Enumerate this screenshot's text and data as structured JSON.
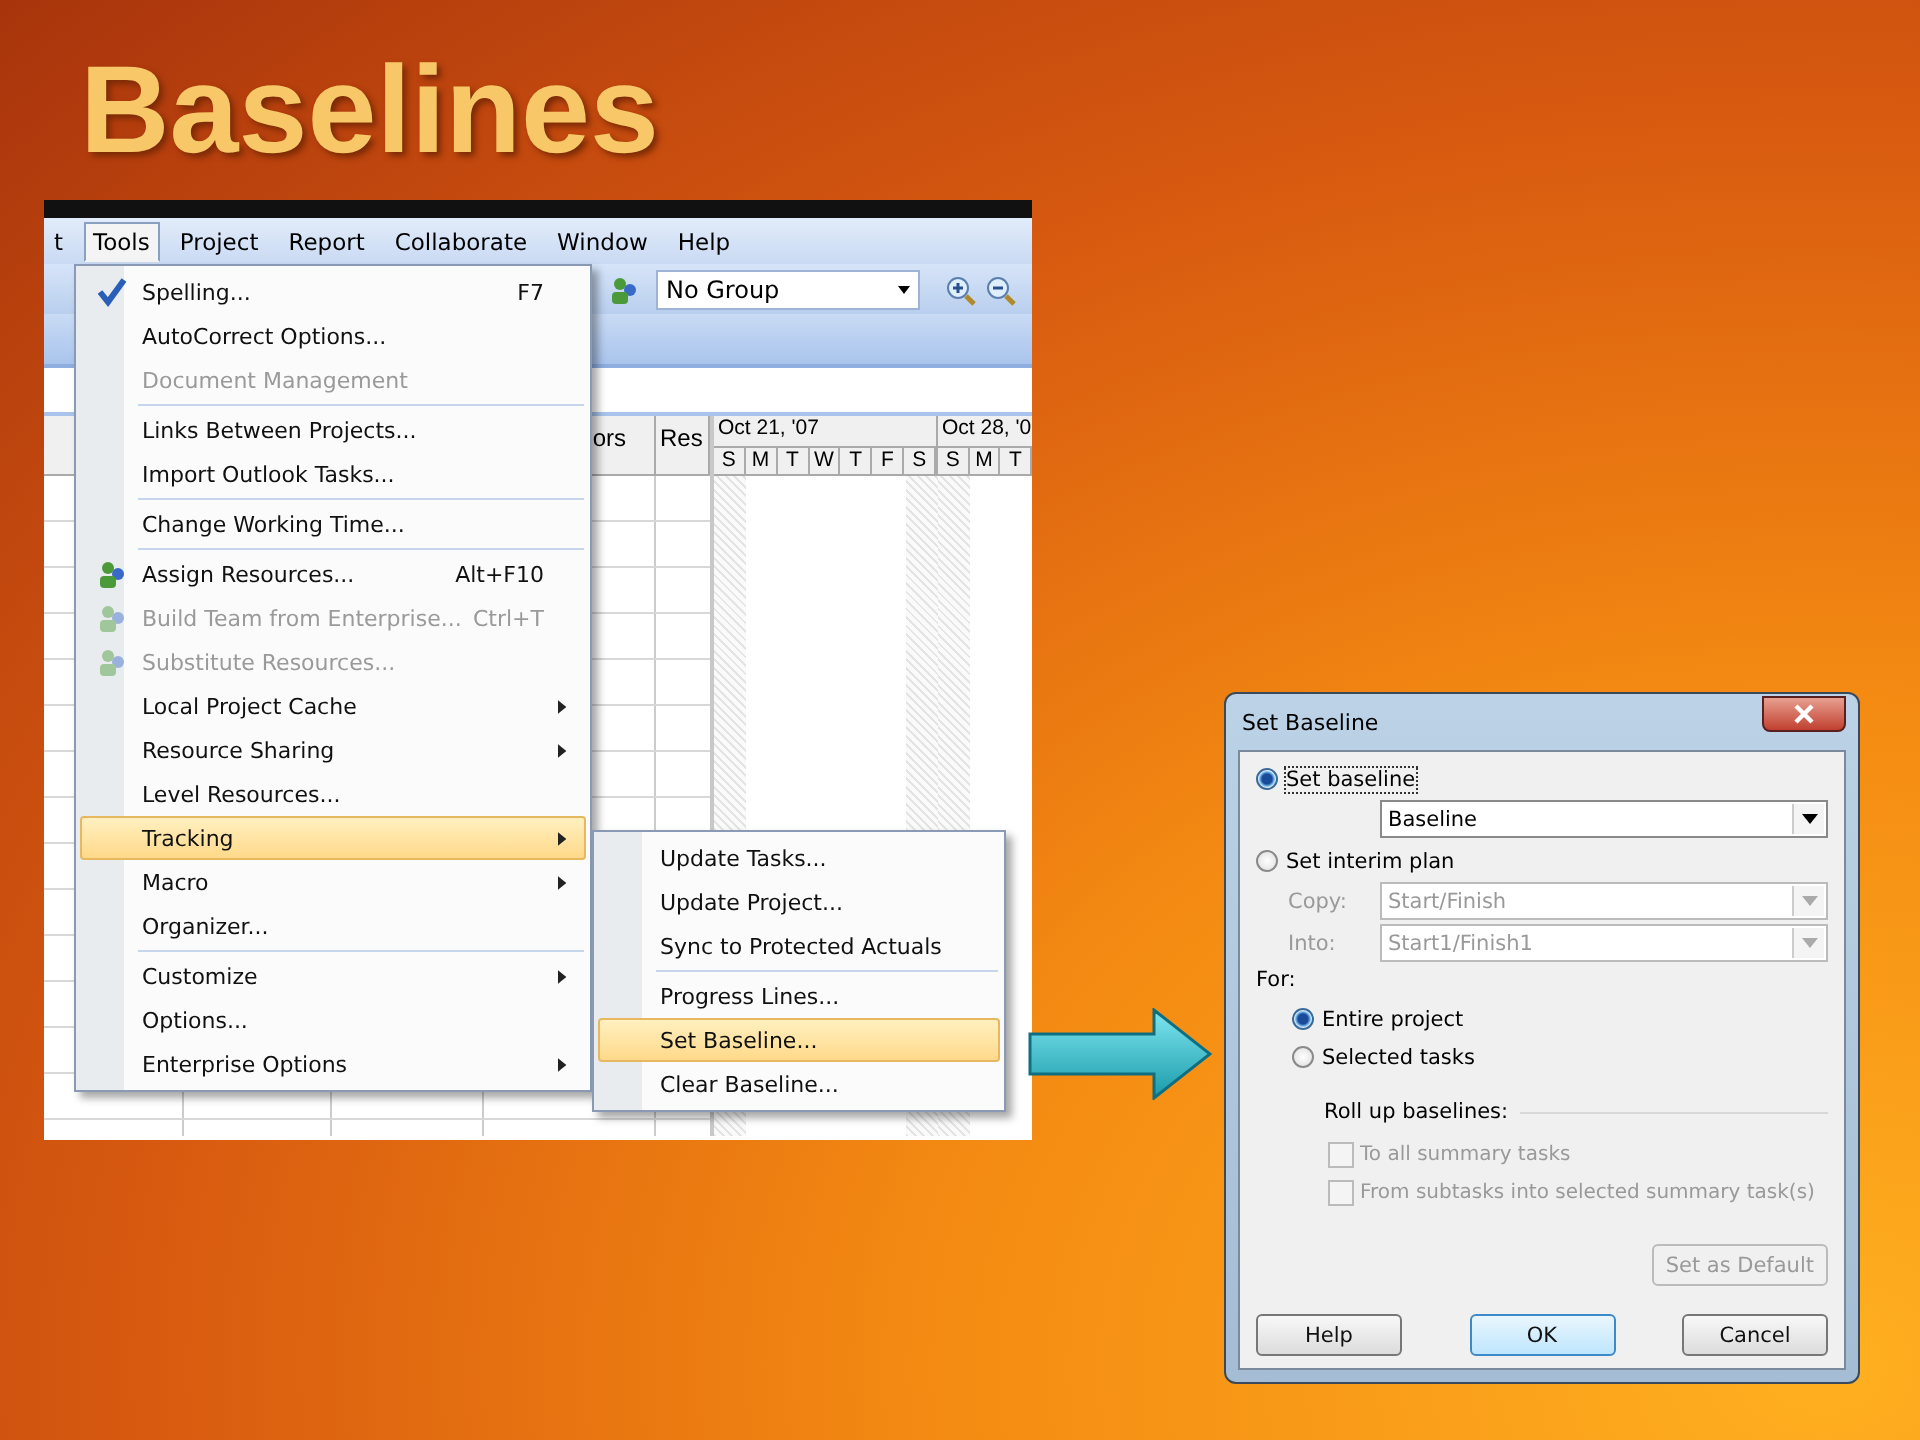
{
  "slide": {
    "title": "Baselines"
  },
  "app": {
    "menu_bar": [
      {
        "label": "t",
        "selected": false
      },
      {
        "label": "Tools",
        "selected": true
      },
      {
        "label": "Project",
        "selected": false
      },
      {
        "label": "Report",
        "selected": false
      },
      {
        "label": "Collaborate",
        "selected": false
      },
      {
        "label": "Window",
        "selected": false
      },
      {
        "label": "Help",
        "selected": false
      }
    ],
    "group_dropdown": {
      "value": "No Group"
    },
    "table": {
      "columns": [
        "ors",
        "Res"
      ]
    },
    "timescale": [
      {
        "label": "Oct 21, '07",
        "days": [
          "S",
          "M",
          "T",
          "W",
          "T",
          "F",
          "S"
        ]
      },
      {
        "label": "Oct 28, '0",
        "days": [
          "S",
          "M",
          "T"
        ]
      }
    ]
  },
  "tools_menu": [
    {
      "label": "Spelling...",
      "shortcut": "F7",
      "kind": "spell",
      "disabled": false,
      "group_start": false,
      "submenu": false,
      "selected": false
    },
    {
      "label": "AutoCorrect Options...",
      "kind": "plain",
      "disabled": false,
      "group_start": false,
      "submenu": false,
      "selected": false
    },
    {
      "label": "Document Management",
      "kind": "plain",
      "disabled": true,
      "group_start": false,
      "submenu": false,
      "selected": false
    },
    {
      "label": "Links Between Projects...",
      "kind": "plain",
      "disabled": false,
      "group_start": true,
      "submenu": false,
      "selected": false
    },
    {
      "label": "Import Outlook Tasks...",
      "kind": "plain",
      "disabled": false,
      "group_start": false,
      "submenu": false,
      "selected": false
    },
    {
      "label": "Change Working Time...",
      "kind": "plain",
      "disabled": false,
      "group_start": true,
      "submenu": false,
      "selected": false
    },
    {
      "label": "Assign Resources...",
      "shortcut": "Alt+F10",
      "kind": "people",
      "disabled": false,
      "group_start": true,
      "submenu": false,
      "selected": false
    },
    {
      "label": "Build Team from Enterprise...",
      "shortcut": "Ctrl+T",
      "kind": "people",
      "disabled": true,
      "group_start": false,
      "submenu": false,
      "selected": false
    },
    {
      "label": "Substitute Resources...",
      "kind": "people",
      "disabled": true,
      "group_start": false,
      "submenu": false,
      "selected": false
    },
    {
      "label": "Local Project Cache",
      "kind": "plain",
      "disabled": false,
      "group_start": false,
      "submenu": true,
      "selected": false
    },
    {
      "label": "Resource Sharing",
      "kind": "plain",
      "disabled": false,
      "group_start": false,
      "submenu": true,
      "selected": false
    },
    {
      "label": "Level Resources...",
      "kind": "plain",
      "disabled": false,
      "group_start": false,
      "submenu": false,
      "selected": false
    },
    {
      "label": "Tracking",
      "kind": "plain",
      "disabled": false,
      "group_start": false,
      "submenu": true,
      "selected": true
    },
    {
      "label": "Macro",
      "kind": "plain",
      "disabled": false,
      "group_start": false,
      "submenu": true,
      "selected": false
    },
    {
      "label": "Organizer...",
      "kind": "plain",
      "disabled": false,
      "group_start": false,
      "submenu": false,
      "selected": false
    },
    {
      "label": "Customize",
      "kind": "plain",
      "disabled": false,
      "group_start": true,
      "submenu": true,
      "selected": false
    },
    {
      "label": "Options...",
      "kind": "plain",
      "disabled": false,
      "group_start": false,
      "submenu": false,
      "selected": false
    },
    {
      "label": "Enterprise Options",
      "kind": "plain",
      "disabled": false,
      "group_start": false,
      "submenu": true,
      "selected": false
    }
  ],
  "tracking_menu": [
    {
      "label": "Update Tasks...",
      "group_start": false,
      "selected": false
    },
    {
      "label": "Update Project...",
      "group_start": false,
      "selected": false
    },
    {
      "label": "Sync to Protected Actuals",
      "group_start": false,
      "selected": false
    },
    {
      "label": "Progress Lines...",
      "group_start": true,
      "selected": false
    },
    {
      "label": "Set Baseline...",
      "group_start": false,
      "selected": true
    },
    {
      "label": "Clear Baseline...",
      "group_start": false,
      "selected": false
    }
  ],
  "dialog": {
    "title": "Set Baseline",
    "baseline_radio": {
      "label": "Set baseline",
      "selected": true
    },
    "baseline_dropdown": {
      "value": "Baseline",
      "disabled": false
    },
    "interim_radio": {
      "label": "Set interim plan",
      "selected": false
    },
    "copy": {
      "label": "Copy:",
      "value": "Start/Finish",
      "disabled": true
    },
    "into": {
      "label": "Into:",
      "value": "Start1/Finish1",
      "disabled": true
    },
    "for_label": "For:",
    "for_options": [
      {
        "label": "Entire project",
        "selected": true
      },
      {
        "label": "Selected tasks",
        "selected": false
      }
    ],
    "rollup_label": "Roll up baselines:",
    "rollup_options": [
      {
        "label": "To all summary tasks",
        "checked": false,
        "disabled": true
      },
      {
        "label": "From subtasks into selected summary task(s)",
        "checked": false,
        "disabled": true
      }
    ],
    "set_default_button": {
      "label": "Set as Default",
      "disabled": true
    },
    "buttons": [
      {
        "label": "Help",
        "default": false
      },
      {
        "label": "OK",
        "default": true
      },
      {
        "label": "Cancel",
        "default": false
      }
    ]
  }
}
